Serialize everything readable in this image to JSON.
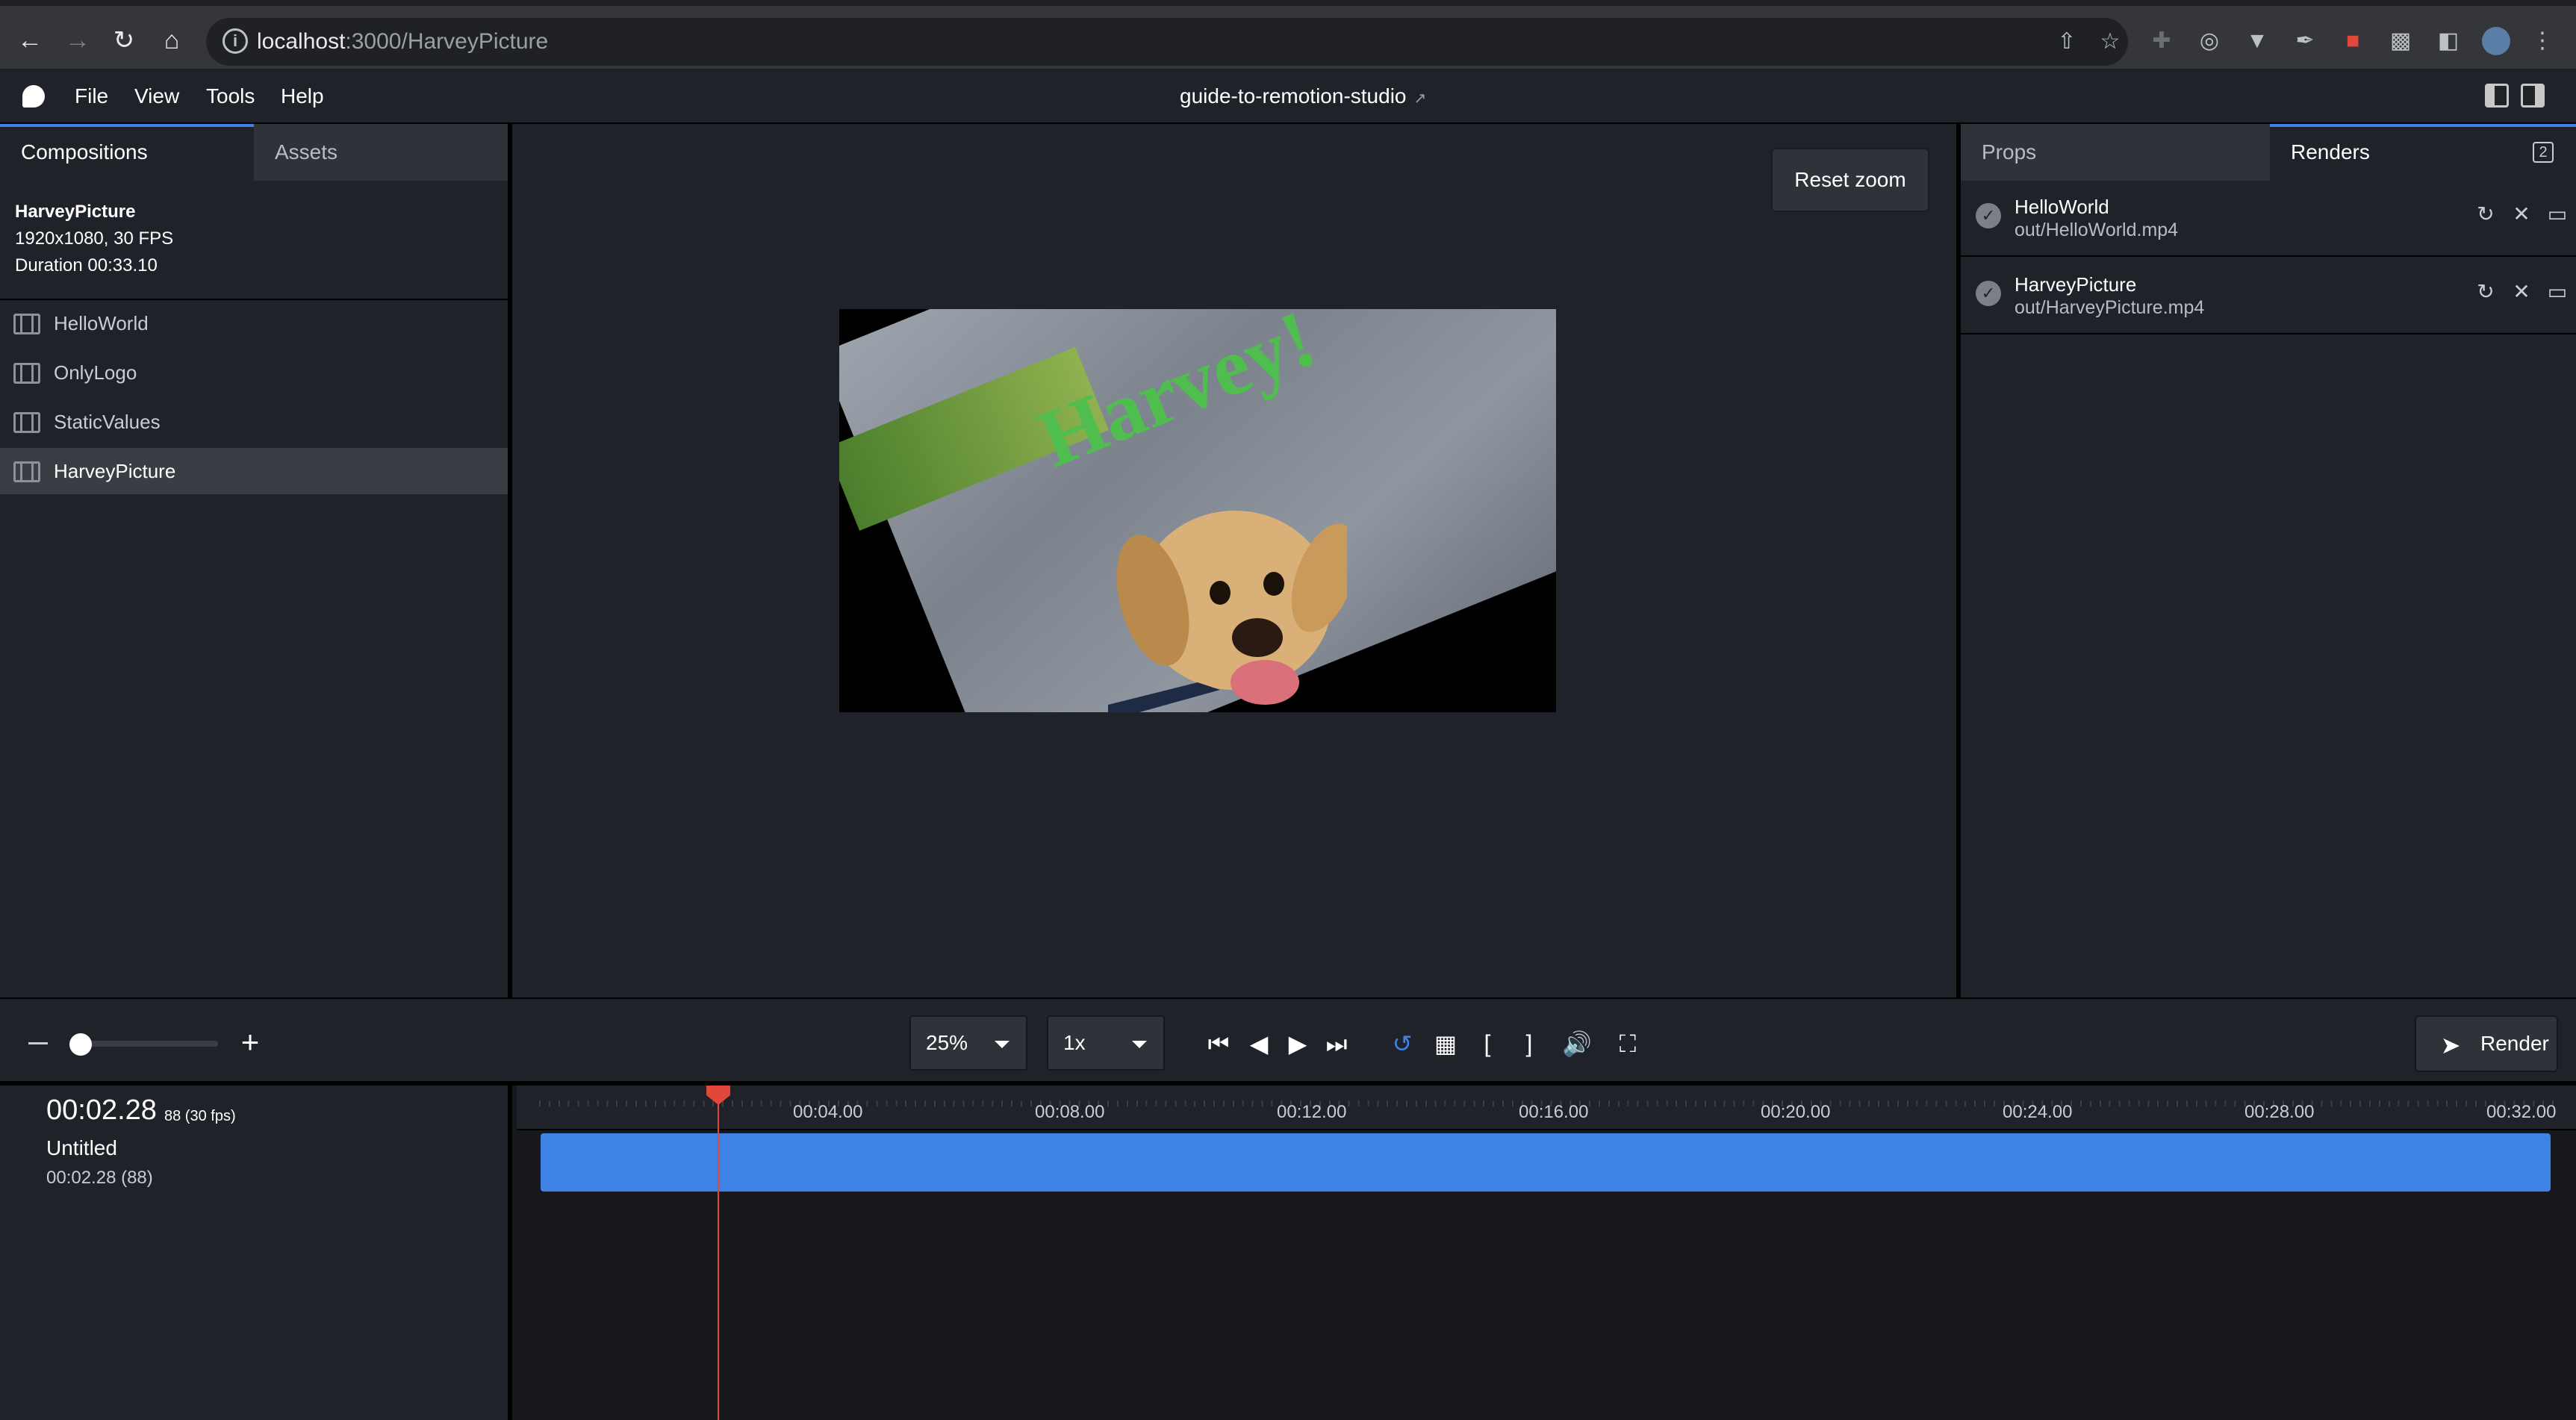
{
  "browser": {
    "url_host": "localhost",
    "url_path": ":3000/HarveyPicture"
  },
  "menubar": {
    "items": [
      "File",
      "View",
      "Tools",
      "Help"
    ],
    "title": "guide-to-remotion-studio"
  },
  "left_panel": {
    "tabs": [
      "Compositions",
      "Assets"
    ],
    "composition": {
      "name": "HarveyPicture",
      "resolution": "1920x1080, 30 FPS",
      "duration": "Duration 00:33.10"
    },
    "items": [
      "HelloWorld",
      "OnlyLogo",
      "StaticValues",
      "HarveyPicture"
    ],
    "selected_index": 3
  },
  "canvas": {
    "reset_zoom_label": "Reset zoom",
    "preview_text": "Harvey!",
    "preview_text_color": "#4fbe4f"
  },
  "right_panel": {
    "tabs": [
      "Props",
      "Renders"
    ],
    "badge": "2",
    "renders": [
      {
        "name": "HelloWorld",
        "path": "out/HelloWorld.mp4"
      },
      {
        "name": "HarveyPicture",
        "path": "out/HarveyPicture.mp4"
      }
    ]
  },
  "controls": {
    "zoom_select": "25%",
    "speed_select": "1x",
    "render_label": "Render",
    "zoom_level": 0.02,
    "accent_color": "#3e82e6"
  },
  "timeline": {
    "timecode": "00:02.28",
    "frames": "88 (30 fps)",
    "track_name": "Untitled",
    "track_time": "00:02.28 (88)",
    "ruler_labels": [
      "00:04.00",
      "00:08.00",
      "00:12.00",
      "00:16.00",
      "00:20.00",
      "00:24.00",
      "00:28.00",
      "00:32.00"
    ],
    "playhead_color": "#e2483a",
    "track_color": "#3e82e6"
  }
}
